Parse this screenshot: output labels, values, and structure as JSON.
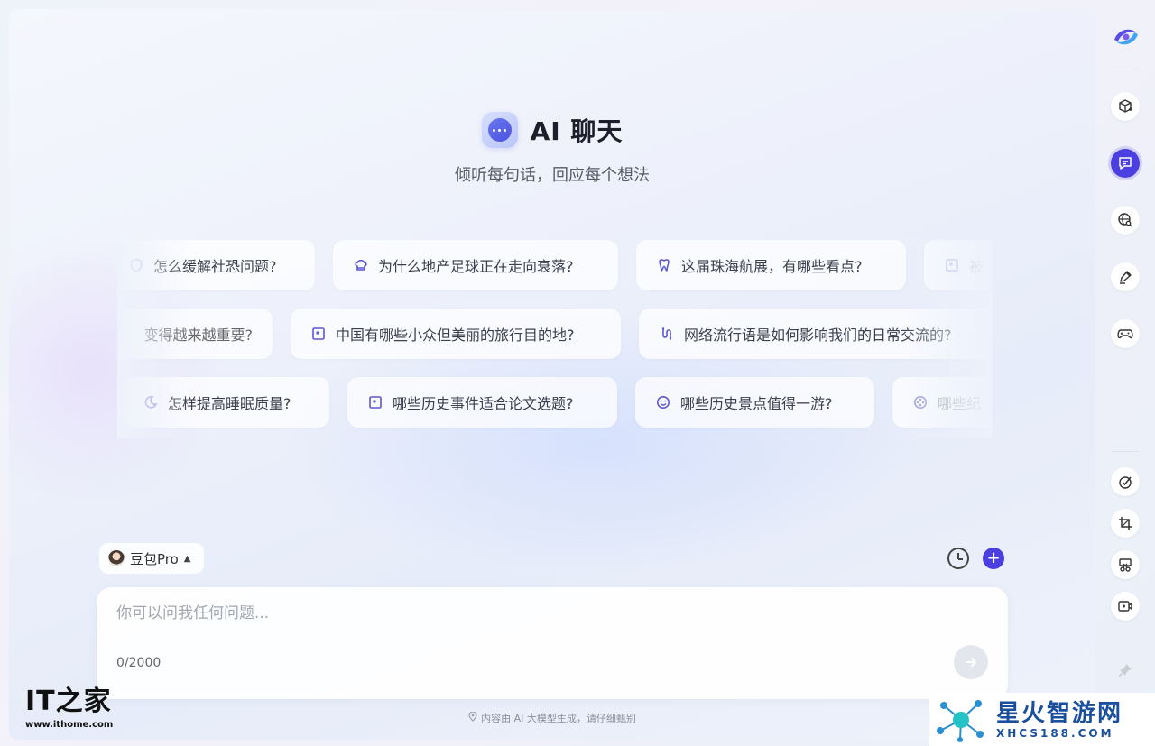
{
  "header": {
    "title": "AI 聊天",
    "subtitle": "倾听每句话，回应每个想法"
  },
  "suggestions": {
    "row1": [
      {
        "icon": "shield-icon",
        "label": "怎么缓解社恐问题?"
      },
      {
        "icon": "chef-hat-icon",
        "label": "为什么地产足球正在走向衰落?"
      },
      {
        "icon": "tooth-icon",
        "label": "这届珠海航展，有哪些看点?"
      },
      {
        "icon": "note-icon",
        "label": "被"
      }
    ],
    "row2": [
      {
        "icon": "",
        "label": "变得越来越重要?"
      },
      {
        "icon": "note-icon",
        "label": "中国有哪些小众但美丽的旅行目的地?"
      },
      {
        "icon": "route-icon",
        "label": "网络流行语是如何影响我们的日常交流的?"
      }
    ],
    "row3": [
      {
        "icon": "moon-icon",
        "label": "怎样提高睡眠质量?"
      },
      {
        "icon": "note-icon",
        "label": "哪些历史事件适合论文选题?"
      },
      {
        "icon": "smile-icon",
        "label": "哪些历史景点值得一游?"
      },
      {
        "icon": "film-icon",
        "label": "哪些纪"
      }
    ]
  },
  "composer": {
    "model_label": "豆包Pro",
    "placeholder": "你可以问我任何问题...",
    "counter": "0/2000"
  },
  "footer": {
    "disclaimer": "内容由 AI 大模型生成，请仔细甄别"
  },
  "sidebar": {
    "items": [
      "cube-plus-icon",
      "chat-icon",
      "search-globe-icon",
      "pen-icon",
      "gamepad-icon",
      "check-circle-icon",
      "crop-icon",
      "scissors-icon",
      "video-icon",
      "pin-icon"
    ]
  },
  "watermarks": {
    "left_logo": "IT之家",
    "left_url": "www.ithome.com",
    "right_title": "星火智游网",
    "right_url": "XHCS188.COM"
  },
  "colors": {
    "accent": "#4c3fe0"
  }
}
